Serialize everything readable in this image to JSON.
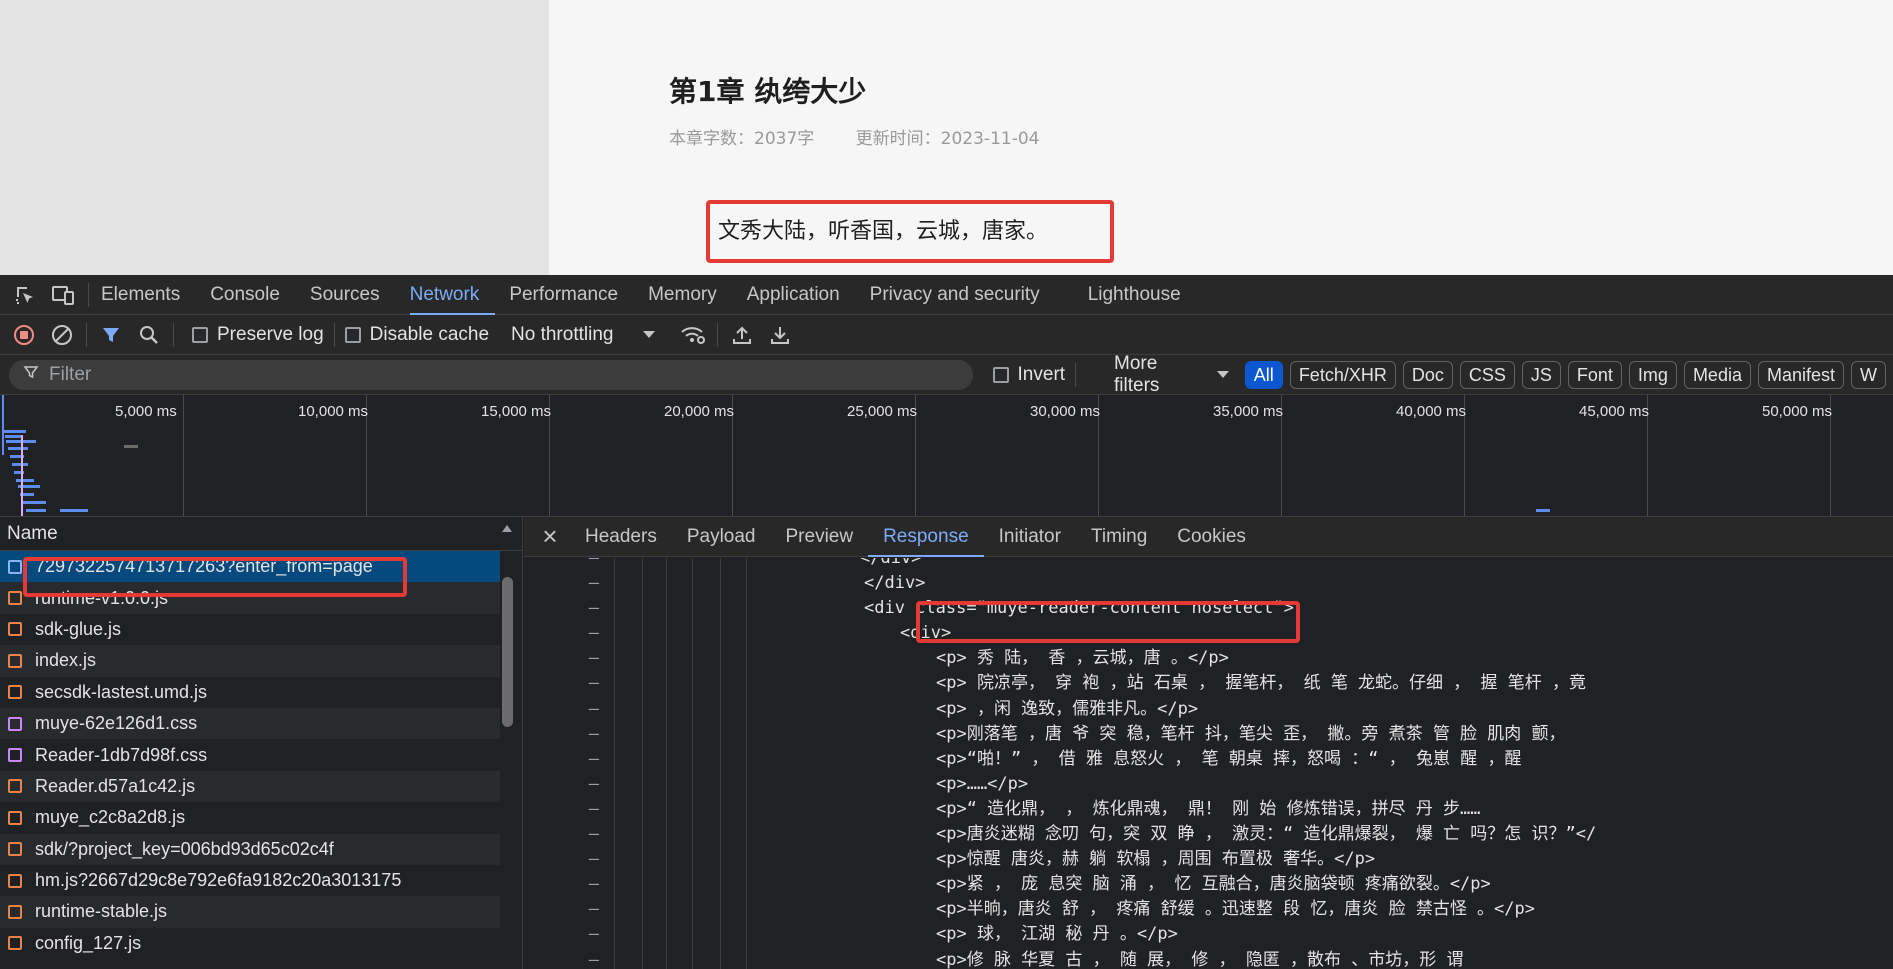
{
  "page": {
    "chapter_title": "第1章 纨绔大少",
    "word_count": "本章字数：2037字",
    "update_time": "更新时间：2023-11-04",
    "first_line": "文秀大陆，听香国，云城，唐家。"
  },
  "devtools": {
    "main_tabs": [
      "Elements",
      "Console",
      "Sources",
      "Network",
      "Performance",
      "Memory",
      "Application",
      "Privacy and security",
      "Lighthouse"
    ],
    "active_main_tab": "Network",
    "toolbar": {
      "preserve_log": "Preserve log",
      "disable_cache": "Disable cache",
      "throttling": "No throttling"
    },
    "filter": {
      "placeholder": "Filter",
      "invert": "Invert",
      "more_filters": "More filters",
      "types": [
        "All",
        "Fetch/XHR",
        "Doc",
        "CSS",
        "JS",
        "Font",
        "Img",
        "Media",
        "Manifest",
        "W"
      ],
      "active_type": "All"
    },
    "timeline_ticks": [
      "5,000 ms",
      "10,000 ms",
      "15,000 ms",
      "20,000 ms",
      "25,000 ms",
      "30,000 ms",
      "35,000 ms",
      "40,000 ms",
      "45,000 ms",
      "50,000 ms"
    ],
    "request_list": {
      "header": "Name",
      "rows": [
        {
          "name": "7297322574713717263?enter_from=page",
          "type": "doc"
        },
        {
          "name": "runtime-v1.0.0.js",
          "type": "js"
        },
        {
          "name": "sdk-glue.js",
          "type": "js"
        },
        {
          "name": "index.js",
          "type": "js"
        },
        {
          "name": "secsdk-lastest.umd.js",
          "type": "js"
        },
        {
          "name": "muye-62e126d1.css",
          "type": "css"
        },
        {
          "name": "Reader-1db7d98f.css",
          "type": "css"
        },
        {
          "name": "Reader.d57a1c42.js",
          "type": "js"
        },
        {
          "name": "muye_c2c8a2d8.js",
          "type": "js"
        },
        {
          "name": "sdk/?project_key=006bd93d65c02c4f",
          "type": "js"
        },
        {
          "name": "hm.js?2667d29c8e792e6fa9182c20a3013175",
          "type": "js"
        },
        {
          "name": "runtime-stable.js",
          "type": "js"
        },
        {
          "name": "config_127.js",
          "type": "js"
        }
      ]
    },
    "detail_tabs": [
      "Headers",
      "Payload",
      "Preview",
      "Response",
      "Initiator",
      "Timing",
      "Cookies"
    ],
    "active_detail_tab": "Response",
    "response_lines": [
      "</div>",
      "</div>",
      "<div class=\"muye-reader-content noselect\">",
      "<div>",
      "<p> 秀  陆，  香 ，云城，唐 。</p>",
      "<p> 院凉亭，     穿 袍    ，站   石桌 ，  握笔杆，     纸  笔  龙蛇。仔细   ，  握  笔杆   ，竟",
      "<p>      ，闲  逸致，儒雅非凡。</p>",
      "<p>刚落笔     ，唐  爷     突   稳，笔杆  抖，笔尖  歪，            撇。旁  煮茶  管  脸  肌肉  颤，",
      "<p>“啪！”       ，   借  雅  息怒火     ，  笔   朝桌   摔，怒喝 ：“   ，     兔崽  醒     ，醒",
      "<p>……</p>",
      "<p>“   造化鼎，           ，  炼化鼎魂，     鼎！   刚  始  修炼错误，拼尽        丹      步……",
      "<p>唐炎迷糊  念叨  句，突  双  睁 ，     激灵：“      造化鼎爆裂，    爆   亡  吗？怎       识？”</",
      "<p>惊醒     唐炎，赫       躺     软榻 ，周围  布置极  奢华。</p>",
      "<p>紧   ，   庞     息突   脑  涌 ，        忆  互融合，唐炎脑袋顿  疼痛欲裂。</p>",
      "<p>半晌，唐炎    舒    ，  疼痛  舒缓   。迅速整     段  忆，唐炎  脸    禁古怪   。</p>",
      "<p>      球，    江湖    秘  丹  。</p>",
      "<p>修    脉  华夏  古    ，    随      展，   修  ，     隐匿  ，散布      、市坊，形    谓"
    ]
  }
}
